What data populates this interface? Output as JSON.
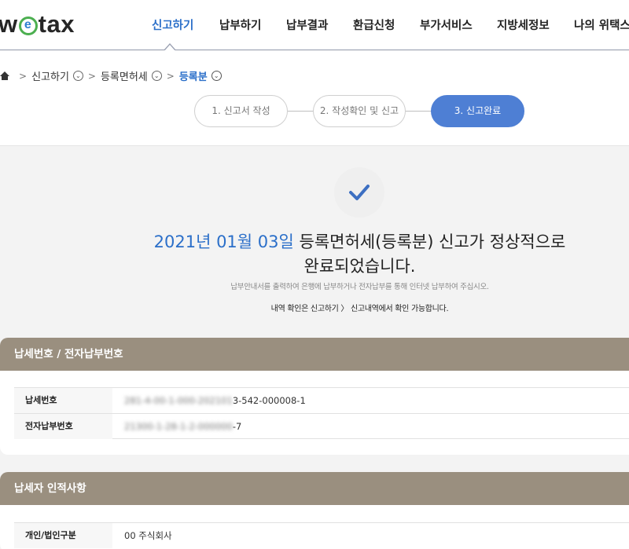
{
  "header": {
    "logo_pre": "w",
    "logo_e": "e",
    "logo_post": "tax",
    "nav": [
      "신고하기",
      "납부하기",
      "납부결과",
      "환급신청",
      "부가서비스",
      "지방세정보",
      "나의 위택스"
    ]
  },
  "breadcrumb": {
    "items": [
      "신고하기",
      "등록면허세",
      "등록분"
    ]
  },
  "steps": [
    "1. 신고서 작성",
    "2. 작성확인 및 신고",
    "3. 신고완료"
  ],
  "completion": {
    "date": "2021년 01월 03일",
    "message_rest": " 등록면허세(등록분) 신고가 정상적으로",
    "message_line2": "완료되었습니다.",
    "sub_note": "납부안내서를 출력하여 은행에 납부하거나 전자납부를 통해 인터넷 납부하여 주십시오.",
    "sub_note2": "내역 확인은 신고하기 〉 신고내역에서 확인 가능합니다."
  },
  "section_payment": {
    "title": "납세번호 / 전자납부번호",
    "rows": [
      {
        "label": "납세번호",
        "masked": "281-4-00-1-000-202101",
        "value": "3-542-000008-1"
      },
      {
        "label": "전자납부번호",
        "masked": "21300-1-28-1-2-000000",
        "value": "-7"
      }
    ]
  },
  "section_taxpayer": {
    "title": "납세자 인적사항",
    "rows": [
      {
        "label": "개인/법인구분",
        "value": "00 주식회사"
      }
    ]
  },
  "colors": {
    "accent": "#2b6fc9",
    "step_active": "#4e7fd4",
    "section_header": "#9a8f7f",
    "logo_green": "#4caf50"
  }
}
